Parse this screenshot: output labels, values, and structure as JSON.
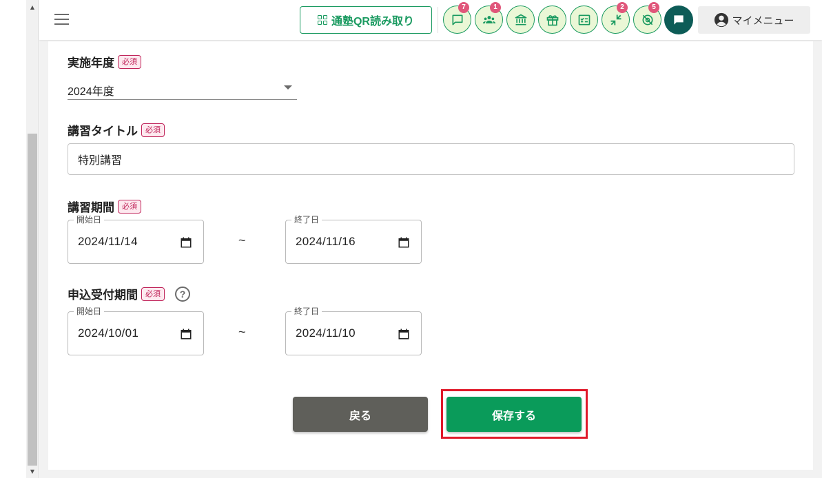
{
  "header": {
    "qr_button_label": "通塾QR読み取り",
    "icon_buttons": [
      {
        "name": "message-icon",
        "badge": "7"
      },
      {
        "name": "group-icon",
        "badge": "1"
      },
      {
        "name": "bank-icon",
        "badge": ""
      },
      {
        "name": "gift-icon",
        "badge": ""
      },
      {
        "name": "checklist-icon",
        "badge": ""
      },
      {
        "name": "compress-icon",
        "badge": "2"
      },
      {
        "name": "no-location-icon",
        "badge": "5"
      }
    ],
    "badges": {
      "message": "7",
      "group": "1",
      "compress": "2",
      "no_location": "5"
    },
    "my_menu_label": "マイメニュー",
    "colors": {
      "accent": "#1a9a60",
      "icon_bg": "#eaf7d6",
      "badge": "#e0567a",
      "chat": "#0d5c57"
    }
  },
  "form": {
    "required_label": "必須",
    "year": {
      "label": "実施年度",
      "value": "2024年度"
    },
    "title": {
      "label": "講習タイトル",
      "value": "特別講習"
    },
    "course_period": {
      "label": "講習期間",
      "start_label": "開始日",
      "start_value": "2024/11/14",
      "end_label": "終了日",
      "end_value": "2024/11/16",
      "separator": "~"
    },
    "application_period": {
      "label": "申込受付期間",
      "help": "?",
      "start_label": "開始日",
      "start_value": "2024/10/01",
      "end_label": "終了日",
      "end_value": "2024/11/10",
      "separator": "~"
    }
  },
  "actions": {
    "back_label": "戻る",
    "save_label": "保存する",
    "colors": {
      "back": "#5f5f5a",
      "save": "#0a9b5a",
      "highlight": "#e0192a"
    }
  }
}
